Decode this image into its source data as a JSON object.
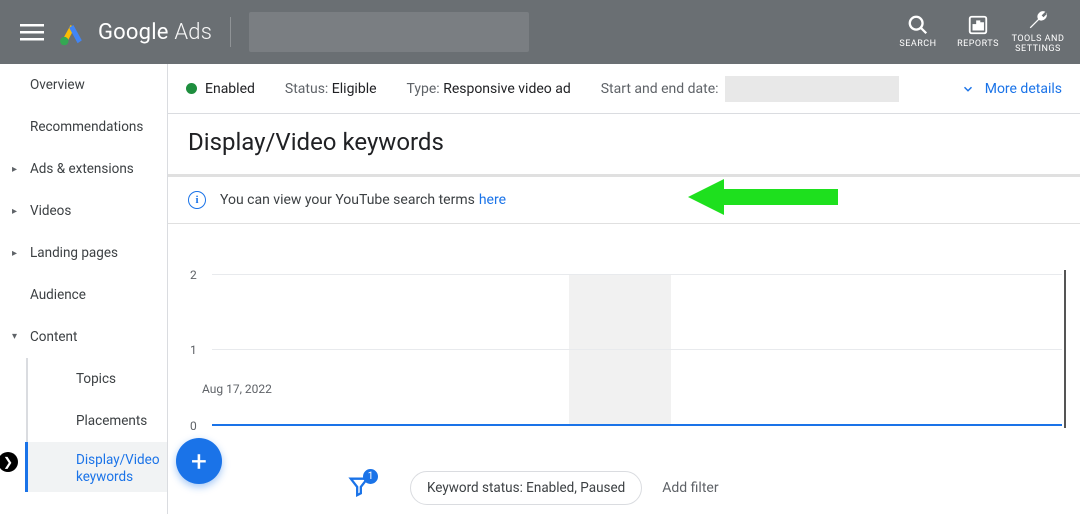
{
  "header": {
    "brand_primary": "Google",
    "brand_secondary": "Ads",
    "actions": {
      "search": "SEARCH",
      "reports": "REPORTS",
      "tools": "TOOLS AND SETTINGS"
    }
  },
  "sidebar": {
    "items": [
      {
        "label": "Overview"
      },
      {
        "label": "Recommendations"
      },
      {
        "label": "Ads & extensions",
        "caret": "▸"
      },
      {
        "label": "Videos",
        "caret": "▸"
      },
      {
        "label": "Landing pages",
        "caret": "▸"
      },
      {
        "label": "Audience"
      },
      {
        "label": "Content",
        "caret": "▾",
        "expanded": true
      }
    ],
    "content_children": [
      {
        "label": "Topics"
      },
      {
        "label": "Placements"
      },
      {
        "label": "Display/Video keywords",
        "active": true
      }
    ]
  },
  "status_bar": {
    "enabled": "Enabled",
    "status_label": "Status:",
    "status_value": "Eligible",
    "type_label": "Type:",
    "type_value": "Responsive video ad",
    "dates_label": "Start and end date:",
    "more": "More details"
  },
  "page": {
    "title": "Display/Video keywords"
  },
  "notice": {
    "text": "You can view your YouTube search terms",
    "link": "here"
  },
  "chart_data": {
    "type": "line",
    "ylim": [
      0,
      2
    ],
    "yticks": [
      0,
      1,
      2
    ],
    "series": [
      {
        "name": "metric",
        "values": [
          0
        ]
      }
    ],
    "x_start_label": "Aug 17, 2022",
    "shaded_region": {
      "left_pct": 42,
      "width_pct": 12
    }
  },
  "toolbar": {
    "fab": "+",
    "filter_badge": "1",
    "chip": "Keyword status: Enabled, Paused",
    "add_filter": "Add filter"
  },
  "colors": {
    "primary": "#1a73e8",
    "header_bg": "#6a6f73",
    "green": "#1e8e3e",
    "arrow": "#1ee01e"
  }
}
